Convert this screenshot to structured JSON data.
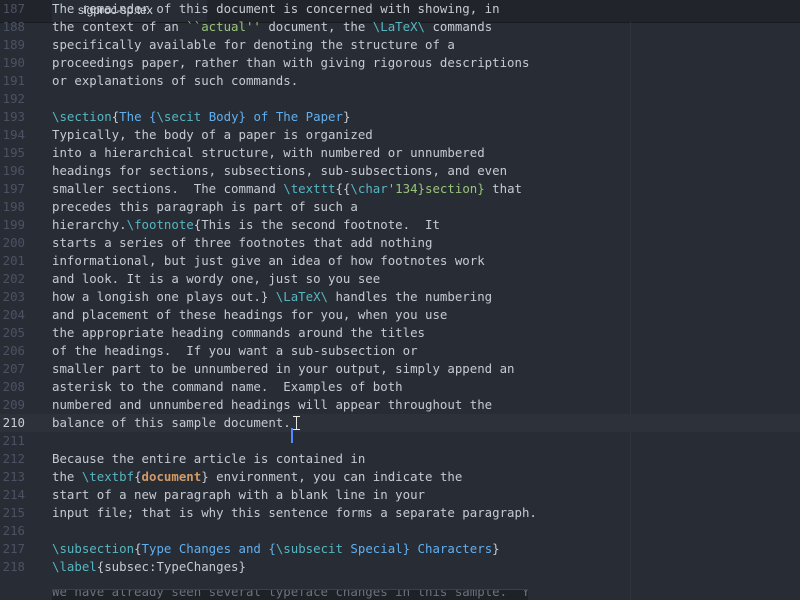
{
  "tab": {
    "title": "sigproc-sp.tex"
  },
  "editor": {
    "lines": [
      {
        "n": "187",
        "segs": [
          {
            "t": "The remainder of this document is concerned with showing, in",
            "c": ""
          }
        ]
      },
      {
        "n": "188",
        "segs": [
          {
            "t": "the context of an ",
            "c": ""
          },
          {
            "t": "``actual''",
            "c": "str"
          },
          {
            "t": " document, the ",
            "c": ""
          },
          {
            "t": "\\LaTeX\\",
            "c": "cmd"
          },
          {
            "t": " commands",
            "c": ""
          }
        ]
      },
      {
        "n": "189",
        "segs": [
          {
            "t": "specifically available for denoting the structure of a",
            "c": ""
          }
        ]
      },
      {
        "n": "190",
        "segs": [
          {
            "t": "proceedings paper, rather than with giving rigorous descriptions",
            "c": ""
          }
        ]
      },
      {
        "n": "191",
        "segs": [
          {
            "t": "or explanations of such commands.",
            "c": ""
          }
        ]
      },
      {
        "n": "192",
        "segs": []
      },
      {
        "n": "193",
        "segs": [
          {
            "t": "\\section",
            "c": "cmd"
          },
          {
            "t": "{",
            "c": "brace"
          },
          {
            "t": "The {",
            "c": "arg"
          },
          {
            "t": "\\secit",
            "c": "cmd"
          },
          {
            "t": " Body} of The Paper",
            "c": "arg"
          },
          {
            "t": "}",
            "c": "brace"
          }
        ]
      },
      {
        "n": "194",
        "segs": [
          {
            "t": "Typically, the body of a paper is organized",
            "c": ""
          }
        ]
      },
      {
        "n": "195",
        "segs": [
          {
            "t": "into a hierarchical structure, with numbered or unnumbered",
            "c": ""
          }
        ]
      },
      {
        "n": "196",
        "segs": [
          {
            "t": "headings for sections, subsections, sub-subsections, and even",
            "c": ""
          }
        ]
      },
      {
        "n": "197",
        "segs": [
          {
            "t": "smaller sections.  The command ",
            "c": ""
          },
          {
            "t": "\\texttt",
            "c": "cmd"
          },
          {
            "t": "{{",
            "c": "brace"
          },
          {
            "t": "\\char",
            "c": "cmd"
          },
          {
            "t": "'134}section}",
            "c": "str"
          },
          {
            "t": " that",
            "c": ""
          }
        ]
      },
      {
        "n": "198",
        "segs": [
          {
            "t": "precedes this paragraph is part of such a",
            "c": ""
          }
        ]
      },
      {
        "n": "199",
        "segs": [
          {
            "t": "hierarchy.",
            "c": ""
          },
          {
            "t": "\\footnote",
            "c": "cmd"
          },
          {
            "t": "{This is the second footnote.  It",
            "c": ""
          }
        ]
      },
      {
        "n": "200",
        "segs": [
          {
            "t": "starts a series of three footnotes that add nothing",
            "c": ""
          }
        ]
      },
      {
        "n": "201",
        "segs": [
          {
            "t": "informational, but just give an idea of how footnotes work",
            "c": ""
          }
        ]
      },
      {
        "n": "202",
        "segs": [
          {
            "t": "and look. It is a wordy one, just so you see",
            "c": ""
          }
        ]
      },
      {
        "n": "203",
        "segs": [
          {
            "t": "how a longish one plays out.} ",
            "c": ""
          },
          {
            "t": "\\LaTeX\\",
            "c": "cmd"
          },
          {
            "t": " handles the numbering",
            "c": ""
          }
        ]
      },
      {
        "n": "204",
        "segs": [
          {
            "t": "and placement of these headings for you, when you use",
            "c": ""
          }
        ]
      },
      {
        "n": "205",
        "segs": [
          {
            "t": "the appropriate heading commands around the titles",
            "c": ""
          }
        ]
      },
      {
        "n": "206",
        "segs": [
          {
            "t": "of the headings.  If you want a sub-subsection or",
            "c": ""
          }
        ]
      },
      {
        "n": "207",
        "segs": [
          {
            "t": "smaller part to be unnumbered in your output, simply append an",
            "c": ""
          }
        ]
      },
      {
        "n": "208",
        "segs": [
          {
            "t": "asterisk to the command name.  Examples of both",
            "c": ""
          }
        ]
      },
      {
        "n": "209",
        "segs": [
          {
            "t": "numbered and unnumbered headings will appear throughout the",
            "c": ""
          }
        ]
      },
      {
        "n": "210",
        "segs": [
          {
            "t": "balance of this sample document.",
            "c": ""
          }
        ],
        "current": true
      },
      {
        "n": "211",
        "segs": []
      },
      {
        "n": "212",
        "segs": [
          {
            "t": "Because the entire article is contained in",
            "c": ""
          }
        ]
      },
      {
        "n": "213",
        "segs": [
          {
            "t": "the ",
            "c": ""
          },
          {
            "t": "\\textbf",
            "c": "cmd"
          },
          {
            "t": "{",
            "c": "brace"
          },
          {
            "t": "document",
            "c": "kw"
          },
          {
            "t": "}",
            "c": "brace"
          },
          {
            "t": " environment, you can indicate the",
            "c": ""
          }
        ]
      },
      {
        "n": "214",
        "segs": [
          {
            "t": "start of a new paragraph with a blank line in your",
            "c": ""
          }
        ]
      },
      {
        "n": "215",
        "segs": [
          {
            "t": "input file; that is why this sentence forms a separate paragraph.",
            "c": ""
          }
        ]
      },
      {
        "n": "216",
        "segs": []
      },
      {
        "n": "217",
        "segs": [
          {
            "t": "\\subsection",
            "c": "cmd"
          },
          {
            "t": "{",
            "c": "brace"
          },
          {
            "t": "Type Changes and {",
            "c": "arg"
          },
          {
            "t": "\\subsecit",
            "c": "cmd"
          },
          {
            "t": " Special} Characters",
            "c": "arg"
          },
          {
            "t": "}",
            "c": "brace"
          }
        ]
      },
      {
        "n": "218",
        "segs": [
          {
            "t": "\\label",
            "c": "cmd"
          },
          {
            "t": "{subsec:TypeChanges}",
            "c": ""
          }
        ]
      }
    ],
    "tooltip_text": "We have already seen several typeface changes in this sample.  You"
  }
}
